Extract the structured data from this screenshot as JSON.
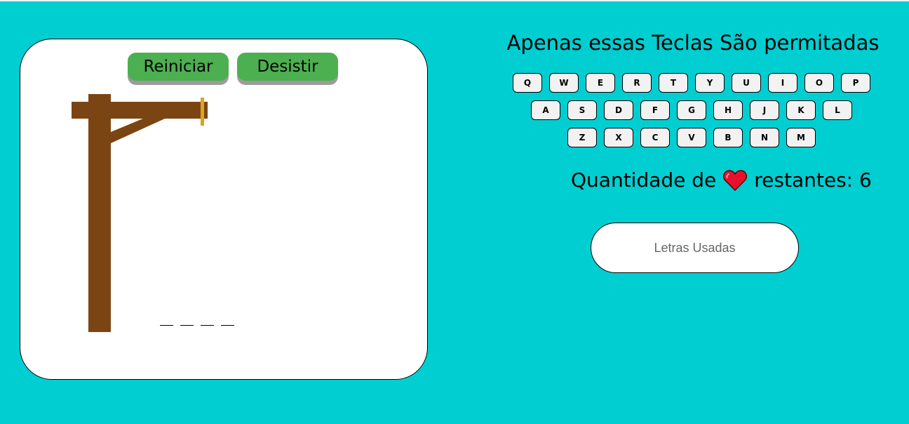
{
  "buttons": {
    "restart_label": "Reiniciar",
    "giveup_label": "Desistir"
  },
  "header": {
    "title": "Apenas essas Teclas São permitadas"
  },
  "keyboard": {
    "row1": [
      "Q",
      "W",
      "E",
      "R",
      "T",
      "Y",
      "U",
      "I",
      "O",
      "P"
    ],
    "row2": [
      "A",
      "S",
      "D",
      "F",
      "G",
      "H",
      "J",
      "K",
      "L"
    ],
    "row3": [
      "Z",
      "X",
      "C",
      "V",
      "B",
      "N",
      "M"
    ]
  },
  "lives": {
    "label_before": "Quantidade de",
    "label_after": "restantes: 6",
    "icon": "heart-icon"
  },
  "used_letters": {
    "placeholder": "Letras Usadas"
  },
  "word": {
    "slots": 4
  },
  "colors": {
    "background": "#00CED1",
    "button": "#4CAF50",
    "wood": "#7B4513",
    "rope": "#DAA520",
    "heart": "#E8112D"
  }
}
